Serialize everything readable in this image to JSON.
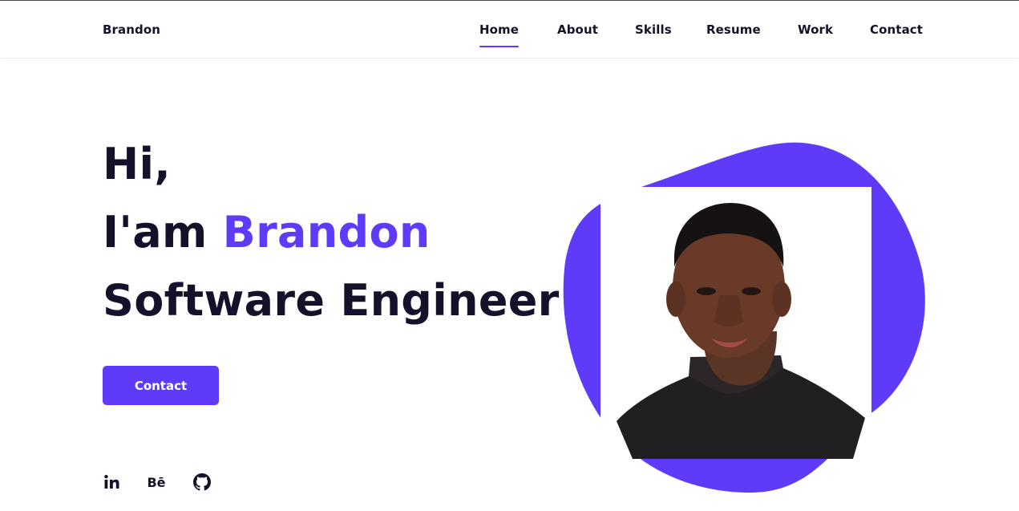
{
  "brand": {
    "name": "Brandon"
  },
  "nav": {
    "items": [
      {
        "label": "Home",
        "active": true
      },
      {
        "label": "About",
        "active": false
      },
      {
        "label": "Skills",
        "active": false
      },
      {
        "label": "Resume",
        "active": false
      },
      {
        "label": "Work",
        "active": false
      },
      {
        "label": "Contact",
        "active": false
      }
    ]
  },
  "hero": {
    "greeting": "Hi,",
    "intro_prefix": "I'am ",
    "name": "Brandon",
    "role": "Software Engineer",
    "cta_label": "Contact"
  },
  "social": [
    {
      "icon": "linkedin-icon",
      "text": "in"
    },
    {
      "icon": "behance-icon",
      "text": "Bē"
    },
    {
      "icon": "github-icon"
    }
  ],
  "colors": {
    "accent": "#5f3af8",
    "heading": "#14122b",
    "background": "#ffffff"
  }
}
